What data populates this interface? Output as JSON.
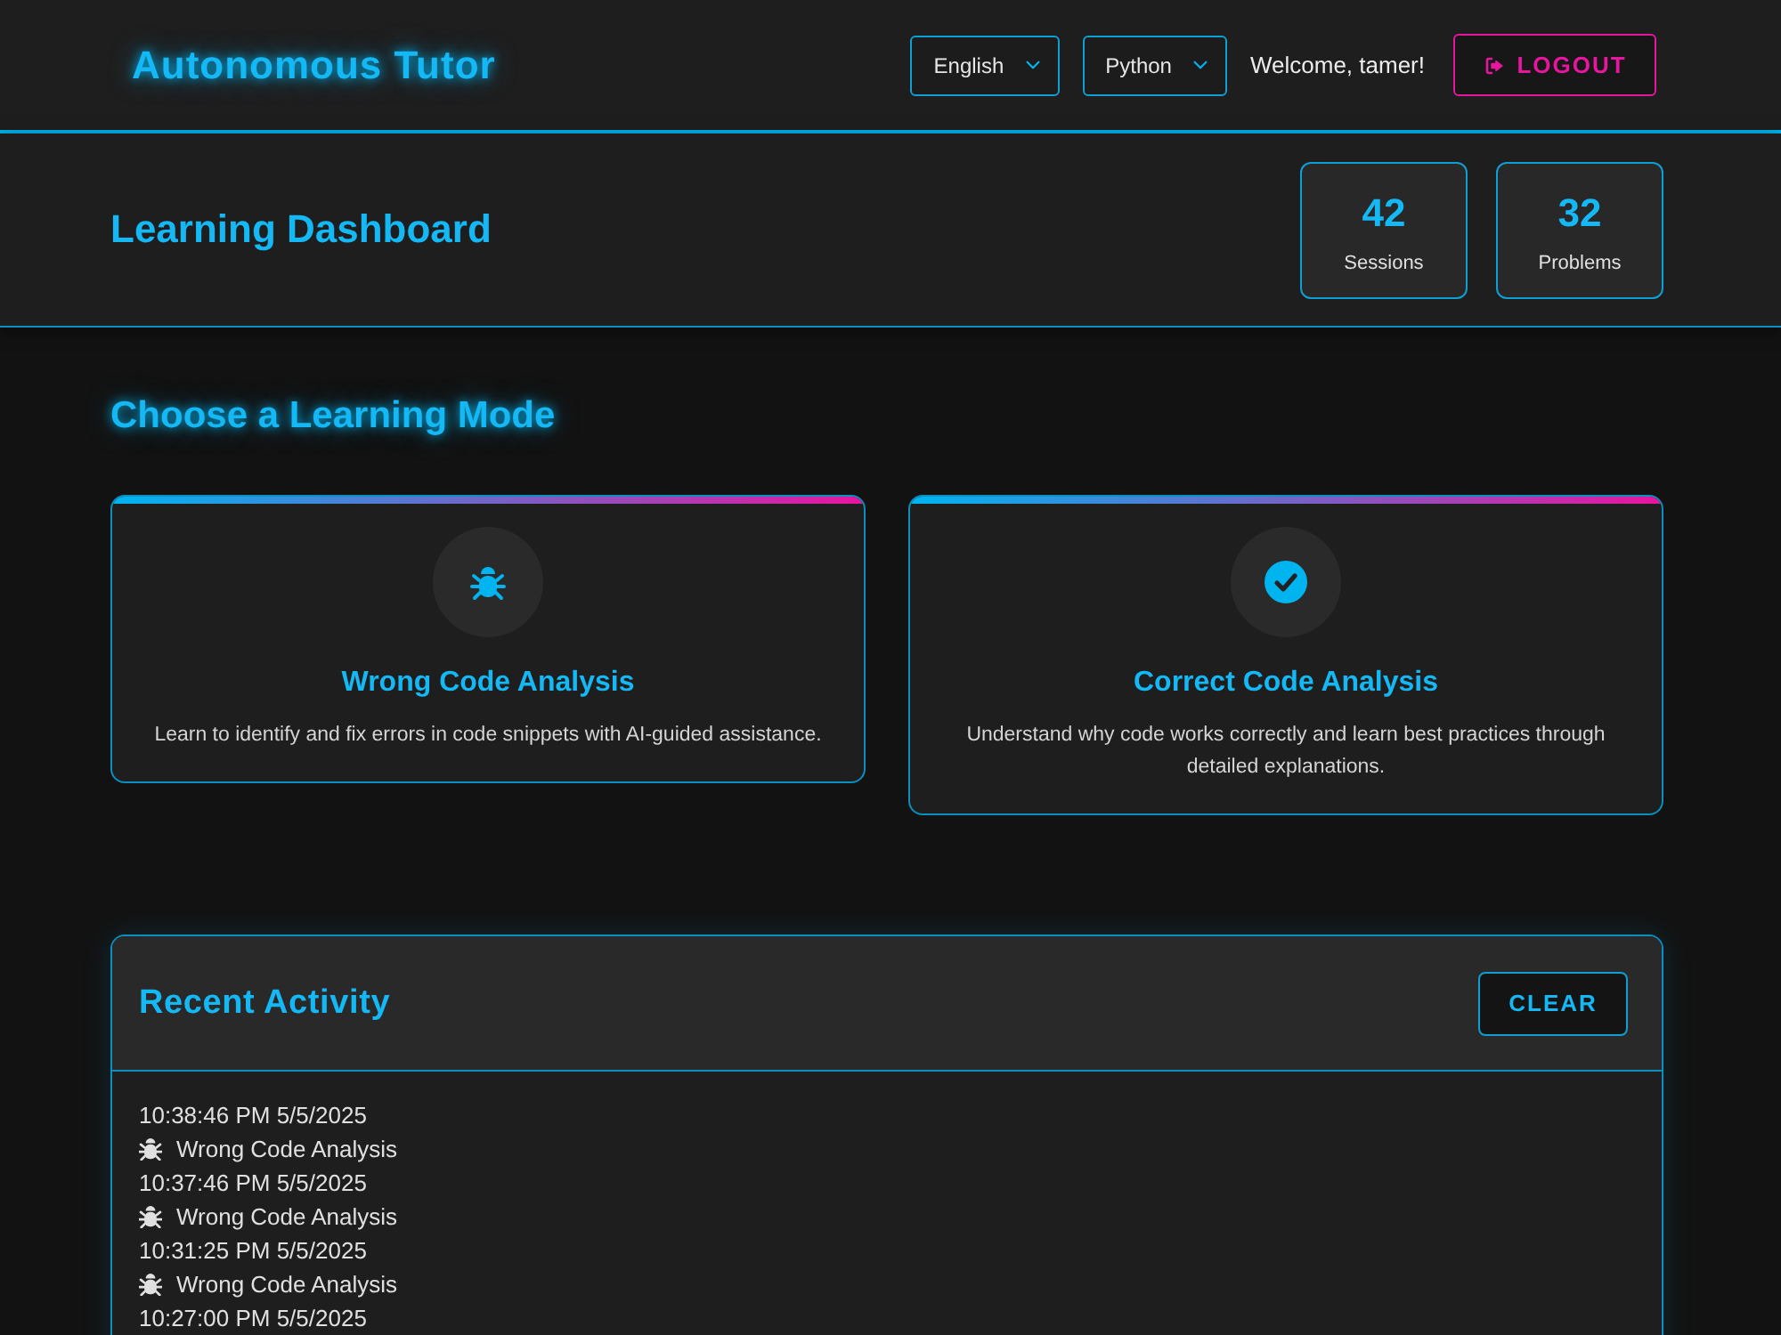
{
  "header": {
    "title": "Autonomous Tutor",
    "selects": [
      {
        "value": "English"
      },
      {
        "value": "Python"
      }
    ],
    "welcome": "Welcome, tamer!",
    "logout_button": "LOGOUT"
  },
  "dashboard": {
    "title": "Learning Dashboard",
    "stats": [
      {
        "value": "42",
        "label": "Sessions"
      },
      {
        "value": "32",
        "label": "Problems"
      }
    ]
  },
  "modes": {
    "heading": "Choose a Learning Mode",
    "cards": [
      {
        "kind": "wrong_code",
        "title": "Wrong Code Analysis",
        "description": "Learn to identify and fix errors in code snippets with AI-guided assistance."
      },
      {
        "kind": "correct_code",
        "title": "Correct Code Analysis",
        "description": "Understand why code works correctly and learn best practices through detailed explanations."
      }
    ]
  },
  "activity": {
    "title": "Recent Activity",
    "clear_button": "CLEAR",
    "entries": [
      {
        "time": "10:38:46 PM 5/5/2025",
        "kind": "wrong_code",
        "mode": "Wrong Code Analysis"
      },
      {
        "time": "10:37:46 PM 5/5/2025",
        "kind": "wrong_code",
        "mode": "Wrong Code Analysis"
      },
      {
        "time": "10:31:25 PM 5/5/2025",
        "kind": "wrong_code",
        "mode": "Wrong Code Analysis"
      },
      {
        "time": "10:27:00 PM 5/5/2025"
      }
    ]
  }
}
